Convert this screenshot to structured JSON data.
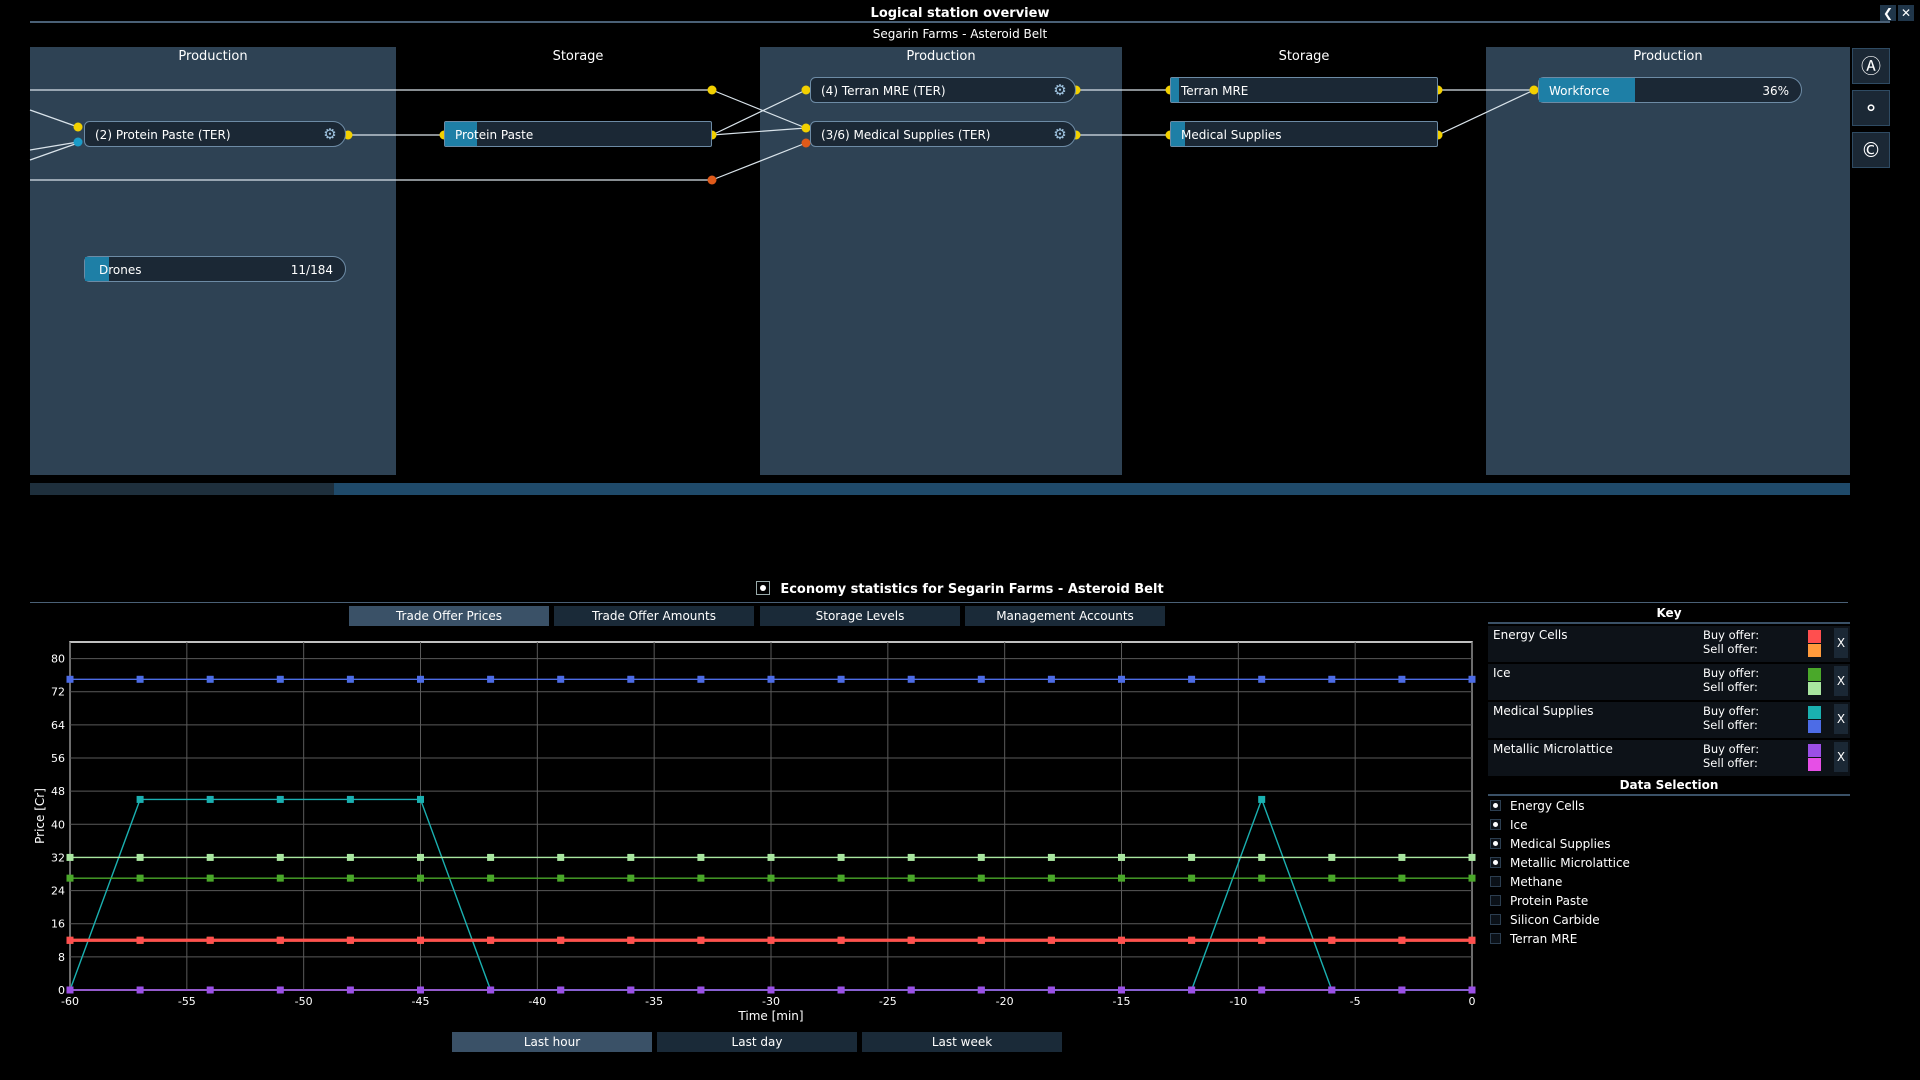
{
  "window": {
    "title": "Logical station overview",
    "subtitle": "Segarin Farms - Asteroid Belt",
    "collapse_icon": "chevron-left-icon",
    "close_icon": "close-icon"
  },
  "columns": [
    {
      "title": "Production",
      "kind": "production"
    },
    {
      "title": "Storage",
      "kind": "storage"
    },
    {
      "title": "Production",
      "kind": "production"
    },
    {
      "title": "Storage",
      "kind": "storage"
    },
    {
      "title": "Production",
      "kind": "production"
    }
  ],
  "nodes": {
    "protein_paste_prod": {
      "label": "(2) Protein Paste (TER)"
    },
    "drones": {
      "label": "Drones",
      "value": "11/184"
    },
    "protein_paste_store": {
      "label": "Protein Paste"
    },
    "terran_mre_prod": {
      "label": "(4) Terran MRE (TER)"
    },
    "medical_supplies_prod": {
      "label": "(3/6) Medical Supplies (TER)"
    },
    "terran_mre_store": {
      "label": "Terran MRE"
    },
    "medical_supplies_store": {
      "label": "Medical Supplies"
    },
    "workforce": {
      "label": "Workforce",
      "value": "36%"
    }
  },
  "sidebar_icons": [
    "architect-icon",
    "share-icon",
    "credits-icon"
  ],
  "economy": {
    "title": "Economy statistics for Segarin Farms - Asteroid Belt",
    "tabs": [
      "Trade Offer Prices",
      "Trade Offer Amounts",
      "Storage Levels",
      "Management Accounts"
    ],
    "active_tab": "Trade Offer Prices",
    "range_tabs": [
      "Last hour",
      "Last day",
      "Last week"
    ],
    "active_range": "Last hour"
  },
  "key": {
    "title": "Key",
    "buy_label": "Buy offer:",
    "sell_label": "Sell offer:",
    "remove_label": "X",
    "items": [
      {
        "name": "Energy Cells",
        "buy_color": "#ff4f4f",
        "sell_color": "#ff9a3c"
      },
      {
        "name": "Ice",
        "buy_color": "#4aa82a",
        "sell_color": "#a9e6a0"
      },
      {
        "name": "Medical Supplies",
        "buy_color": "#1ab0b0",
        "sell_color": "#4d6ce6"
      },
      {
        "name": "Metallic Microlattice",
        "buy_color": "#9b4fe6",
        "sell_color": "#e64fe6"
      }
    ]
  },
  "data_selection": {
    "title": "Data Selection",
    "items": [
      {
        "label": "Energy Cells",
        "checked": true
      },
      {
        "label": "Ice",
        "checked": true
      },
      {
        "label": "Medical Supplies",
        "checked": true
      },
      {
        "label": "Metallic Microlattice",
        "checked": true
      },
      {
        "label": "Methane",
        "checked": false
      },
      {
        "label": "Protein Paste",
        "checked": false
      },
      {
        "label": "Silicon Carbide",
        "checked": false
      },
      {
        "label": "Terran MRE",
        "checked": false
      }
    ]
  },
  "chart_data": {
    "type": "line",
    "xlabel": "Time [min]",
    "ylabel": "Price [Cr]",
    "xlim": [
      -60,
      0
    ],
    "ylim": [
      0,
      84
    ],
    "xticks": [
      -60,
      -55,
      -50,
      -45,
      -40,
      -35,
      -30,
      -25,
      -20,
      -15,
      -10,
      -5,
      0
    ],
    "yticks": [
      0,
      8,
      16,
      24,
      32,
      40,
      48,
      56,
      64,
      72,
      80
    ],
    "grid": true,
    "x": [
      -60,
      -57,
      -54,
      -51,
      -48,
      -45,
      -42,
      -39,
      -36,
      -33,
      -30,
      -27,
      -24,
      -21,
      -18,
      -15,
      -12,
      -9,
      -6,
      -3,
      0
    ],
    "series": [
      {
        "name": "Medical Supplies",
        "offer": "sell",
        "color": "#4d6ce6",
        "values": [
          75,
          75,
          75,
          75,
          75,
          75,
          75,
          75,
          75,
          75,
          75,
          75,
          75,
          75,
          75,
          75,
          75,
          75,
          75,
          75,
          75
        ]
      },
      {
        "name": "Medical Supplies",
        "offer": "buy",
        "color": "#1ab0b0",
        "values": [
          0,
          46,
          46,
          46,
          46,
          46,
          0,
          0,
          0,
          0,
          0,
          0,
          0,
          0,
          0,
          0,
          0,
          46,
          0,
          0,
          0
        ]
      },
      {
        "name": "Ice",
        "offer": "sell",
        "color": "#a9e6a0",
        "values": [
          32,
          32,
          32,
          32,
          32,
          32,
          32,
          32,
          32,
          32,
          32,
          32,
          32,
          32,
          32,
          32,
          32,
          32,
          32,
          32,
          32
        ]
      },
      {
        "name": "Ice",
        "offer": "buy",
        "color": "#4aa82a",
        "values": [
          27,
          27,
          27,
          27,
          27,
          27,
          27,
          27,
          27,
          27,
          27,
          27,
          27,
          27,
          27,
          27,
          27,
          27,
          27,
          27,
          27
        ]
      },
      {
        "name": "Energy Cells",
        "offer": "sell",
        "color": "#ff9a3c",
        "values": [
          12,
          12,
          12,
          12,
          12,
          12,
          12,
          12,
          12,
          12,
          12,
          12,
          12,
          12,
          12,
          12,
          12,
          12,
          12,
          12,
          12
        ]
      },
      {
        "name": "Energy Cells",
        "offer": "buy",
        "color": "#ff4f4f",
        "values": [
          12,
          12,
          12,
          12,
          12,
          12,
          12,
          12,
          12,
          12,
          12,
          12,
          12,
          12,
          12,
          12,
          12,
          12,
          12,
          12,
          12
        ]
      },
      {
        "name": "Metallic Microlattice",
        "offer": "buy",
        "color": "#9b4fe6",
        "values": [
          0,
          0,
          0,
          0,
          0,
          0,
          0,
          0,
          0,
          0,
          0,
          0,
          0,
          0,
          0,
          0,
          0,
          0,
          0,
          0,
          0
        ]
      }
    ]
  }
}
